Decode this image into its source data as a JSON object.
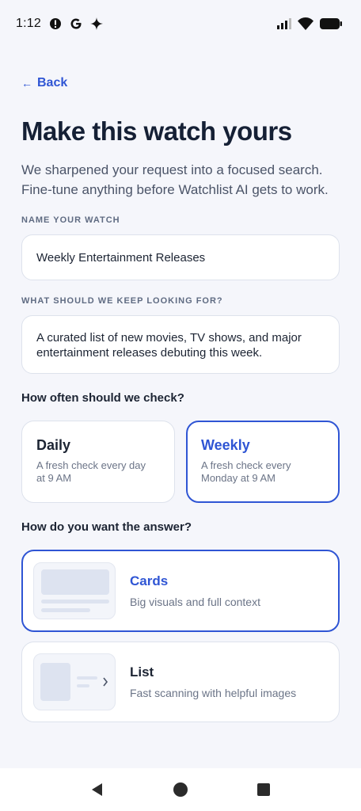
{
  "status_bar": {
    "time": "1:12"
  },
  "back": {
    "label": "Back"
  },
  "header": {
    "title": "Make this watch yours",
    "subtitle": "We sharpened your request into a focused search. Fine-tune anything before Watchlist AI gets to work."
  },
  "name_field": {
    "label": "NAME YOUR WATCH",
    "value": "Weekly Entertainment Releases"
  },
  "query_field": {
    "label": "WHAT SHOULD WE KEEP LOOKING FOR?",
    "value": "A curated list of new movies, TV shows, and major entertainment releases debuting this week."
  },
  "frequency": {
    "label": "How often should we check?",
    "options": [
      {
        "title": "Daily",
        "description": "A fresh check every day at 9 AM",
        "selected": false
      },
      {
        "title": "Weekly",
        "description": "A fresh check every Monday at 9 AM",
        "selected": true
      }
    ]
  },
  "format": {
    "label": "How do you want the answer?",
    "options": [
      {
        "title": "Cards",
        "description": "Big visuals and full context",
        "selected": true
      },
      {
        "title": "List",
        "description": "Fast scanning with helpful images",
        "selected": false
      }
    ]
  },
  "colors": {
    "accent": "#2f55d4",
    "background": "#f5f6fb",
    "card_border": "#dde2ec",
    "thumb_fill": "#dde3f0"
  },
  "icons": {
    "status": [
      "dnd-icon",
      "google-g-icon",
      "sparkle-icon",
      "signal-icon",
      "wifi-icon",
      "battery-icon"
    ],
    "nav": [
      "back-triangle-icon",
      "home-circle-icon",
      "recents-square-icon"
    ]
  }
}
